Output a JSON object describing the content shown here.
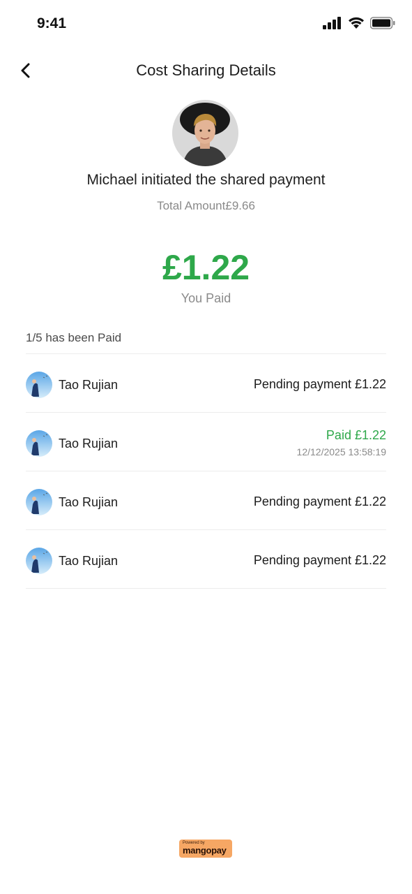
{
  "status_bar": {
    "time": "9:41"
  },
  "header": {
    "title": "Cost Sharing Details",
    "back_icon": "chevron-left-icon"
  },
  "initiator": {
    "text": "Michael initiated the shared payment",
    "total_label": "Total Amount£9.66"
  },
  "you_paid": {
    "amount": "£1.22",
    "label": "You Paid"
  },
  "paid_count": "1/5 has been Paid",
  "participants": [
    {
      "name": "Tao Rujian",
      "status": "Pending payment £1.22"
    },
    {
      "name": "Tao Rujian",
      "status": "Paid £1.22",
      "time": "12/12/2025 13:58:19"
    },
    {
      "name": "Tao Rujian",
      "status": "Pending payment £1.22"
    },
    {
      "name": "Tao Rujian",
      "status": "Pending payment £1.22"
    }
  ],
  "footer": {
    "powered_small": "Powered by",
    "brand": "mangopay"
  },
  "colors": {
    "accent_green": "#2ea84a",
    "muted": "#8a8a8a",
    "badge": "#f6a764"
  }
}
